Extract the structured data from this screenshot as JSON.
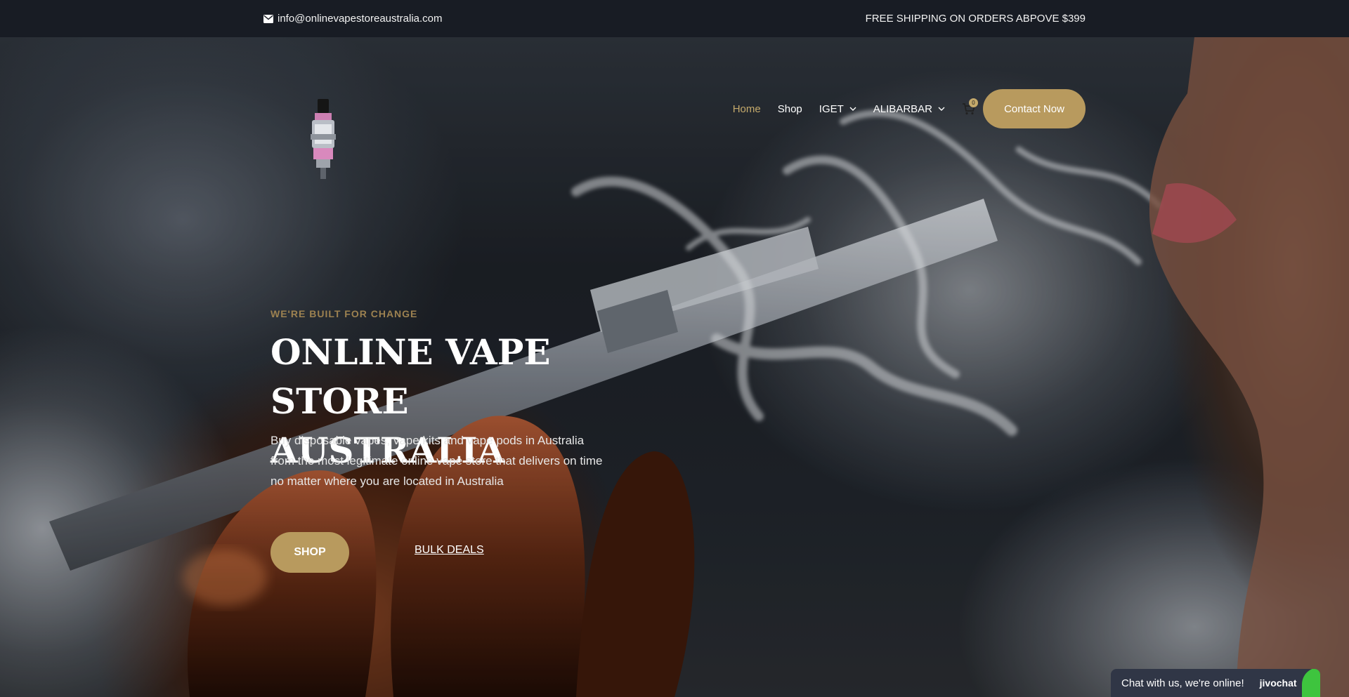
{
  "topbar": {
    "email": "info@onlinevapestoreaustralia.com",
    "shipping": "FREE SHIPPING ON ORDERS ABPOVE $399"
  },
  "nav": {
    "items": [
      {
        "label": "Home",
        "active": true
      },
      {
        "label": "Shop"
      },
      {
        "label": "IGET",
        "dropdown": true
      },
      {
        "label": "ALIBARBAR",
        "dropdown": true
      }
    ],
    "cart_count": "0",
    "contact_label": "Contact Now"
  },
  "hero": {
    "kicker": "WE'RE BUILT FOR CHANGE",
    "headline_line1": "ONLINE VAPE STORE",
    "headline_line2": "AUSTRALIA",
    "subtext": "Buy disposable vapes, vape kits and vape pods  in Australia from the most legitimate online vape store  that delivers on time no matter where you are located in Australia",
    "shop_label": "SHOP",
    "bulk_label": "BULK DEALS"
  },
  "chat": {
    "text": "Chat with us, we're online!",
    "brand": "jivochat"
  },
  "colors": {
    "accent": "#b89a5e",
    "topbar": "#181c24",
    "active_nav": "#c4a96b",
    "chat_bg": "#303646",
    "chat_leaf": "#3ec43e"
  },
  "icons": [
    "envelope-icon",
    "chevron-down-icon",
    "cart-icon",
    "vape-tank-logo"
  ]
}
